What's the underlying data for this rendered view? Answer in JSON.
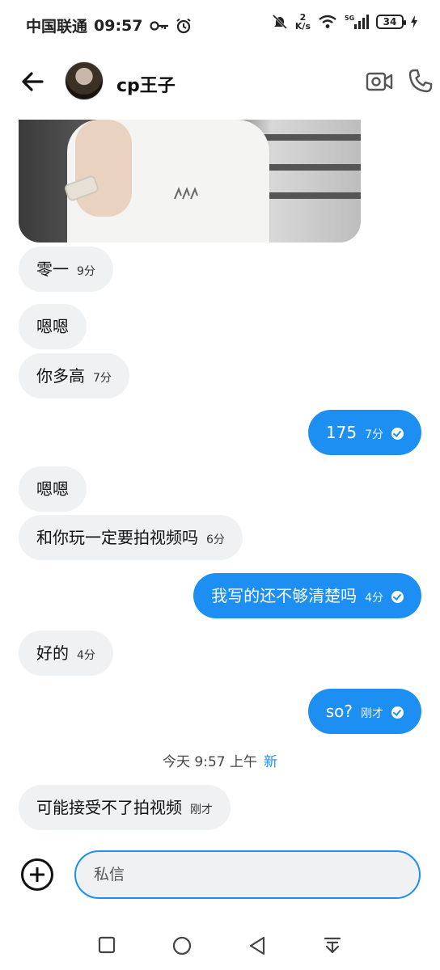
{
  "status_bar": {
    "carrier": "中国联通",
    "time": "09:57",
    "speed_value": "2",
    "speed_unit": "K/s",
    "battery": "34"
  },
  "header": {
    "contact_name": "cp王子"
  },
  "messages": [
    {
      "side": "in",
      "text": "零一",
      "time": "9分"
    },
    {
      "side": "in",
      "text": "嗯嗯",
      "time": ""
    },
    {
      "side": "in",
      "text": "你多高",
      "time": "7分"
    },
    {
      "side": "out",
      "text": "175",
      "time": "7分",
      "read": true
    },
    {
      "side": "in",
      "text": "嗯嗯",
      "time": ""
    },
    {
      "side": "in",
      "text": "和你玩一定要拍视频吗",
      "time": "6分"
    },
    {
      "side": "out",
      "text": "我写的还不够清楚吗",
      "time": "4分",
      "read": true
    },
    {
      "side": "in",
      "text": "好的",
      "time": "4分"
    },
    {
      "side": "out",
      "text": "so?",
      "time": "刚才",
      "read": true
    },
    {
      "side": "in",
      "text": "可能接受不了拍视频",
      "time": "刚才"
    }
  ],
  "day_divider": {
    "label": "今天 9:57 上午",
    "new_label": "新"
  },
  "composer": {
    "placeholder": "私信"
  },
  "colors": {
    "accent": "#1d8ff2",
    "incoming_bubble": "#eff1f3"
  },
  "icons": [
    "back-arrow-icon",
    "video-call-icon",
    "phone-icon",
    "add-icon",
    "square-icon",
    "circle-icon",
    "triangle-back-icon",
    "download-icon",
    "key-icon",
    "alarm-icon",
    "mute-icon",
    "wifi-icon",
    "signal-icon"
  ]
}
